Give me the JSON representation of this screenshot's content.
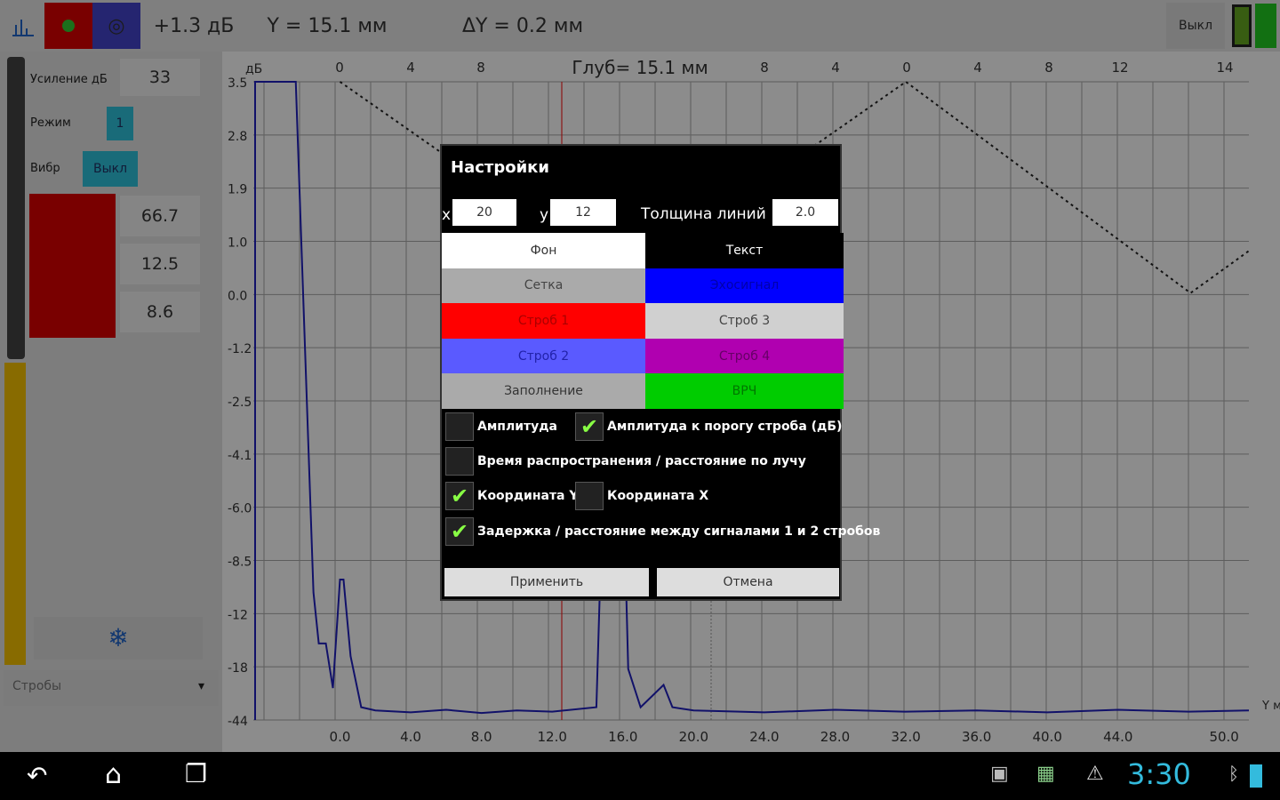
{
  "toolbar": {
    "gain_offset": "+1.3 дБ",
    "y_readout": "Y = 15.1 мм",
    "dy_readout": "ΔY = 0.2 мм",
    "off_button": "Выкл"
  },
  "left_panel": {
    "gain_label": "Усиление дБ",
    "gain_value": "33",
    "mode_label": "Режим",
    "mode_value": "1",
    "vibr_label": "Вибр",
    "vibr_value": "Выкл",
    "values": [
      "66.7",
      "12.5",
      "8.6"
    ],
    "gates_dropdown": "Стробы"
  },
  "chart_data": {
    "type": "line",
    "title": "Глуб= 15.1 мм",
    "ylabel": "дБ",
    "xlabel": "Y мм",
    "y_tick_labels": [
      "3.5",
      "2.8",
      "1.9",
      "1.0",
      "0.0",
      "-1.2",
      "-2.5",
      "-4.1",
      "-6.0",
      "-8.5",
      "-12",
      "-18",
      "-44"
    ],
    "x_tick_labels": [
      "0.0",
      "4.0",
      "8.0",
      "12.0",
      "16.0",
      "20.0",
      "24.0",
      "28.0",
      "32.0",
      "36.0",
      "40.0",
      "44.0",
      "50.0"
    ],
    "top_tick_labels": [
      "0",
      "4",
      "8",
      "8",
      "4",
      "0",
      "4",
      "8",
      "12",
      "14"
    ],
    "xlim": [
      -4.9,
      51.4
    ],
    "signal": [
      [
        -4.8,
        0
      ],
      [
        -4.8,
        100
      ],
      [
        -2.5,
        100
      ],
      [
        -2.0,
        60
      ],
      [
        -1.5,
        20
      ],
      [
        -1.2,
        12
      ],
      [
        -0.8,
        12
      ],
      [
        -0.4,
        5
      ],
      [
        0,
        22
      ],
      [
        0.2,
        22
      ],
      [
        0.6,
        10
      ],
      [
        1.2,
        2
      ],
      [
        2,
        1.5
      ],
      [
        4,
        1.2
      ],
      [
        6,
        1.6
      ],
      [
        8,
        1.1
      ],
      [
        10,
        1.5
      ],
      [
        12,
        1.3
      ],
      [
        14.5,
        2
      ],
      [
        14.8,
        30
      ],
      [
        15.3,
        60
      ],
      [
        16,
        40
      ],
      [
        16.3,
        8
      ],
      [
        17,
        2
      ],
      [
        18.3,
        5.5
      ],
      [
        18.8,
        2
      ],
      [
        20,
        1.5
      ],
      [
        24,
        1.2
      ],
      [
        28,
        1.6
      ],
      [
        32,
        1.3
      ],
      [
        36,
        1.5
      ],
      [
        40,
        1.2
      ],
      [
        44,
        1.6
      ],
      [
        48,
        1.3
      ],
      [
        51.4,
        1.5
      ]
    ],
    "tvg_curve": [
      [
        0,
        100
      ],
      [
        16,
        69
      ],
      [
        32,
        100
      ],
      [
        48.1,
        66.9
      ],
      [
        51.4,
        73.5
      ]
    ],
    "colors": {
      "signal": "#2020c0",
      "gate1": "#ff0000",
      "grid": "#aaaaaa"
    }
  },
  "dialog": {
    "title": "Настройки",
    "x_label": "x",
    "x_value": "20",
    "y_label": "y",
    "y_value": "12",
    "line_width_label": "Толщина линий",
    "line_width_value": "2.0",
    "colors": [
      {
        "label": "Фон",
        "bg": "#ffffff",
        "fg": "#333333"
      },
      {
        "label": "Текст",
        "bg": "#000000",
        "fg": "#ffffff"
      },
      {
        "label": "Сетка",
        "bg": "#aaaaaa",
        "fg": "#444444"
      },
      {
        "label": "Эхосигнал",
        "bg": "#0000ff",
        "fg": "#0000aa"
      },
      {
        "label": "Строб 1",
        "bg": "#ff0000",
        "fg": "#aa0000"
      },
      {
        "label": "Строб 3",
        "bg": "#d0d0d0",
        "fg": "#444444"
      },
      {
        "label": "Строб 2",
        "bg": "#5a5aff",
        "fg": "#2222aa"
      },
      {
        "label": "Строб 4",
        "bg": "#b000b0",
        "fg": "#660066"
      },
      {
        "label": "Заполнение",
        "bg": "#aaaaaa",
        "fg": "#333333"
      },
      {
        "label": "ВРЧ",
        "bg": "#00cc00",
        "fg": "#007700"
      }
    ],
    "checkboxes": [
      {
        "label": "Амплитуда",
        "checked": false
      },
      {
        "label": "Амплитуда к порогу строба (дБ)",
        "checked": true
      },
      {
        "label": "Время распространения / расстояние по лучу",
        "checked": false
      },
      {
        "label": "Координата Y",
        "checked": true
      },
      {
        "label": "Координата X",
        "checked": false
      },
      {
        "label": "Задержка / расстояние между сигналами 1 и 2 стробов",
        "checked": true
      }
    ],
    "apply": "Применить",
    "cancel": "Отмена"
  },
  "status": {
    "time": "3:30"
  }
}
